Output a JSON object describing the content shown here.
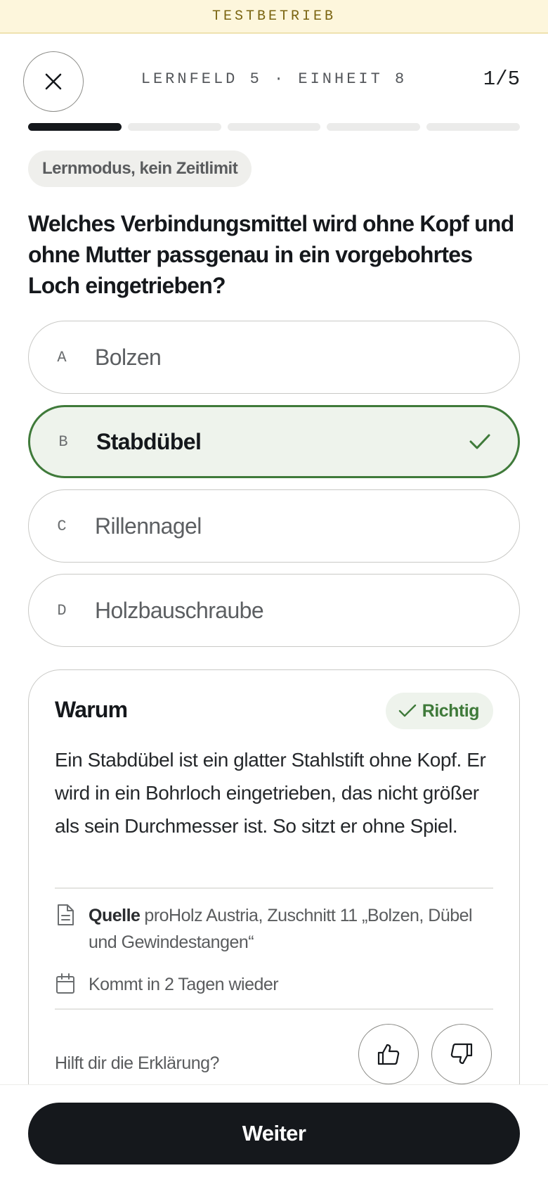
{
  "banner": {
    "text": "TESTBETRIEB"
  },
  "header": {
    "close_icon": "close-icon",
    "unit_label": "LERNFELD 5 · EINHEIT 8",
    "progress_text": "1/5",
    "progress": {
      "current": 1,
      "total": 5
    }
  },
  "mode_pill": "Lernmodus, kein Zeitlimit",
  "question": "Welches Verbindungsmittel wird ohne Kopf und ohne Mutter passgenau in ein vorgebohrtes Loch eingetrieben?",
  "options": [
    {
      "letter": "A",
      "label": "Bolzen",
      "selected": false
    },
    {
      "letter": "B",
      "label": "Stabdübel",
      "selected": true
    },
    {
      "letter": "C",
      "label": "Rillennagel",
      "selected": false
    },
    {
      "letter": "D",
      "label": "Holzbauschraube",
      "selected": false
    }
  ],
  "explanation_card": {
    "title": "Warum",
    "badge": "Richtig",
    "text": "Ein Stabdübel ist ein glatter Stahlstift ohne Kopf. Er wird in ein Bohrloch eingetrieben, das nicht größer als sein Durchmesser ist. So sitzt er ohne Spiel.",
    "source_label": "Quelle",
    "source_text": "proHolz Austria, Zuschnitt 11 „Bolzen, Dübel und Gewindestangen“",
    "review_text": "Kommt in 2 Tagen wieder",
    "feedback_question": "Hilft dir die Erklärung?",
    "icons": {
      "source": "document-icon",
      "review": "calendar-icon",
      "thumbs_up": "thumbs-up-icon",
      "thumbs_down": "thumbs-down-icon",
      "check": "check-icon"
    }
  },
  "footer": {
    "continue_label": "Weiter"
  },
  "colors": {
    "primary": "#15181c",
    "success": "#3f7a3a",
    "success_bg": "#eef3ec",
    "banner_bg": "#fdf6dc",
    "banner_text": "#7a6410"
  }
}
